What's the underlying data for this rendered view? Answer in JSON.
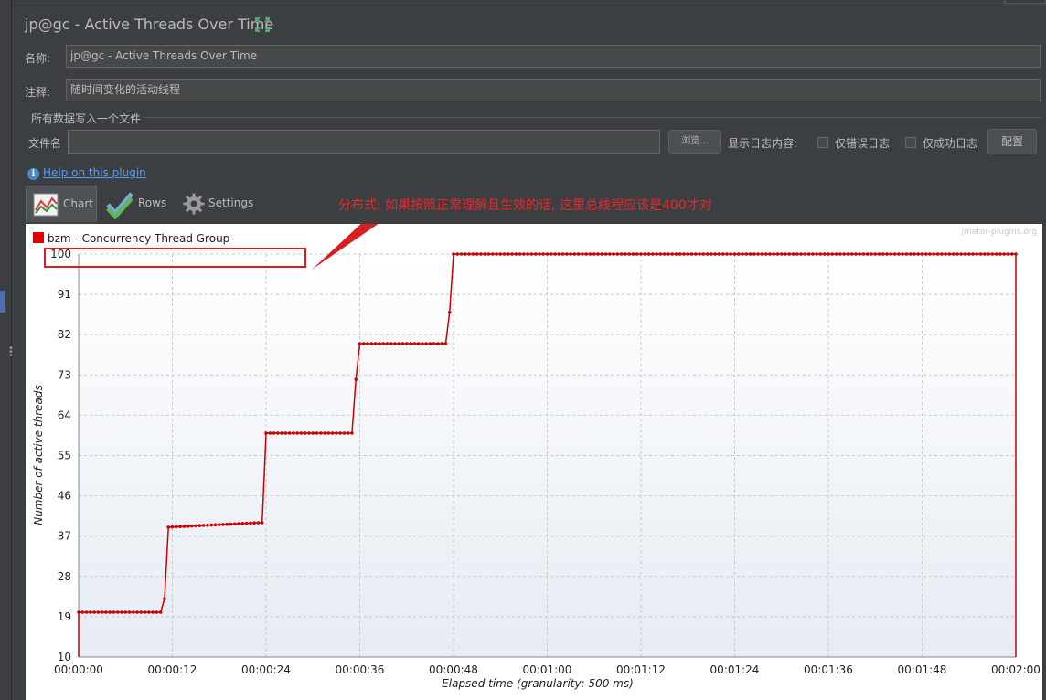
{
  "window": {
    "title": "jp@gc - Active Threads Over Time",
    "name_label": "名称:",
    "name_value": "jp@gc - Active Threads Over Time",
    "comment_label": "注释:",
    "comment_value": "随时间变化的活动线程",
    "group_title": "所有数据写入一个文件",
    "file_label": "文件名",
    "file_value": "",
    "browse_label": "浏览...",
    "log_display_label": "显示日志内容:",
    "errors_only_label": "仅错误日志",
    "success_only_label": "仅成功日志",
    "config_label": "配置",
    "help_link": "Help on this plugin"
  },
  "tabs": [
    {
      "label": "Chart",
      "active": true
    },
    {
      "label": "Rows",
      "active": false
    },
    {
      "label": "Settings",
      "active": false
    }
  ],
  "annotation": "分布式: 如果按照正常理解且生效的话, 这里总线程应该是400才对",
  "colors": {
    "series": "#cc0000",
    "annotation": "#e8282b",
    "accent": "#4b6eaf"
  },
  "chart_data": {
    "type": "line",
    "watermark": "jmeter-plugins.org",
    "xlabel": "Elapsed time (granularity: 500 ms)",
    "ylabel": "Number of active threads",
    "x_ticks": [
      "00:00:00",
      "00:00:12",
      "00:00:24",
      "00:00:36",
      "00:00:48",
      "00:01:00",
      "00:01:12",
      "00:01:24",
      "00:01:36",
      "00:01:48",
      "00:02:00"
    ],
    "y_ticks": [
      10,
      19,
      28,
      37,
      46,
      55,
      64,
      73,
      82,
      91,
      100
    ],
    "xlim_seconds": [
      0,
      120
    ],
    "ylim": [
      10,
      100
    ],
    "grid": true,
    "legend_position": "top-left",
    "series": [
      {
        "name": "bzm - Concurrency Thread Group",
        "x_seconds": [
          0,
          10.5,
          11,
          11.5,
          23,
          23.5,
          24,
          35,
          35.5,
          36,
          47,
          47.5,
          48,
          120
        ],
        "values": [
          20,
          20,
          23,
          39,
          40,
          40,
          60,
          60,
          72,
          80,
          80,
          87,
          100,
          100
        ]
      }
    ]
  }
}
